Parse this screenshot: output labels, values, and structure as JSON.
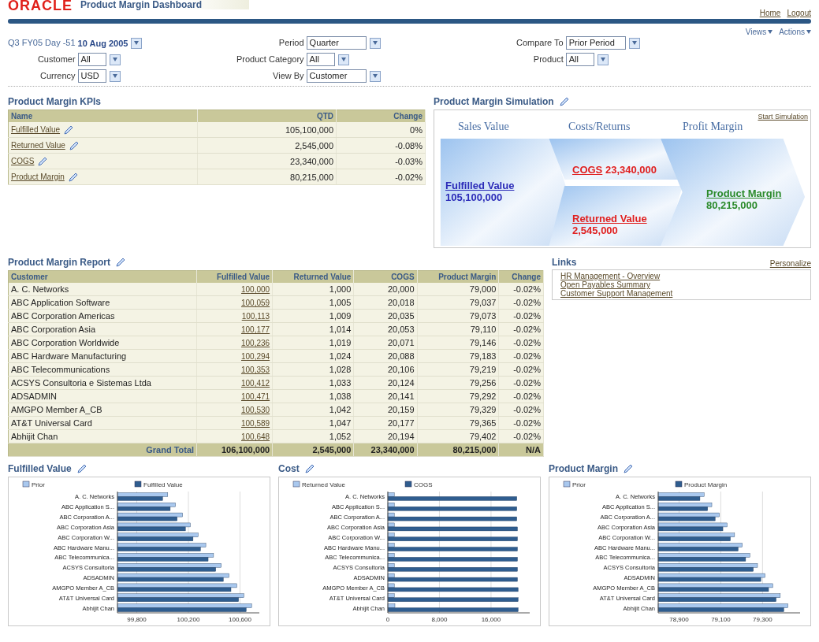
{
  "header": {
    "logo": "ORACLE",
    "title": "Product Margin Dashboard",
    "links": [
      "Home",
      "Logout"
    ]
  },
  "menus": [
    "Views",
    "Actions"
  ],
  "filter_columns": [
    [
      {
        "kind": "date",
        "label": "Q3 FY05 Day -51",
        "value": "10 Aug 2005"
      },
      {
        "kind": "select",
        "label": "Customer",
        "value": "All"
      },
      {
        "kind": "select",
        "label": "Currency",
        "value": "USD"
      }
    ],
    [
      {
        "kind": "select",
        "label": "Period",
        "value": "Quarter"
      },
      {
        "kind": "select",
        "label": "Product Category",
        "value": "All"
      },
      {
        "kind": "select",
        "label": "View By",
        "value": "Customer"
      }
    ],
    [
      {
        "kind": "select",
        "label": "Compare To",
        "value": "Prior Period"
      },
      {
        "kind": "select",
        "label": "Product",
        "value": "All"
      }
    ]
  ],
  "kpis": {
    "title": "Product Margin KPIs",
    "columns": [
      "Name",
      "QTD",
      "Change"
    ],
    "rows": [
      {
        "name": "Fulfilled Value",
        "qtd": "105,100,000",
        "change": "0%"
      },
      {
        "name": "Returned Value",
        "qtd": "2,545,000",
        "change": "-0.08%"
      },
      {
        "name": "COGS",
        "qtd": "23,340,000",
        "change": "-0.03%"
      },
      {
        "name": "Product Margin",
        "qtd": "80,215,000",
        "change": "-0.02%"
      }
    ]
  },
  "simulation": {
    "title": "Product Margin Simulation",
    "action": "Start Simulation",
    "stages": [
      "Sales Value",
      "Costs/Returns",
      "Profit Margin"
    ],
    "items": [
      {
        "label": "Fulfilled Value",
        "value": "105,100,000",
        "color": "#2b2bb8"
      },
      {
        "label": "COGS",
        "value": "23,340,000",
        "color": "#e02020"
      },
      {
        "label": "Returned Value",
        "value": "2,545,000",
        "color": "#e02020"
      },
      {
        "label": "Product Margin",
        "value": "80,215,000",
        "color": "#2a8a2a"
      }
    ]
  },
  "report": {
    "title": "Product Margin Report",
    "columns": [
      "Customer",
      "Fulfilled Value",
      "Returned Value",
      "COGS",
      "Product Margin",
      "Change"
    ],
    "rows": [
      [
        "A. C. Networks",
        "100,000",
        "1,000",
        "20,000",
        "79,000",
        "-0.02%"
      ],
      [
        "ABC Application Software",
        "100,059",
        "1,005",
        "20,018",
        "79,037",
        "-0.02%"
      ],
      [
        "ABC Corporation Americas",
        "100,113",
        "1,009",
        "20,035",
        "79,073",
        "-0.02%"
      ],
      [
        "ABC Corporation Asia",
        "100,177",
        "1,014",
        "20,053",
        "79,110",
        "-0.02%"
      ],
      [
        "ABC Corporation Worldwide",
        "100,236",
        "1,019",
        "20,071",
        "79,146",
        "-0.02%"
      ],
      [
        "ABC Hardware Manufacturing",
        "100,294",
        "1,024",
        "20,088",
        "79,183",
        "-0.02%"
      ],
      [
        "ABC Telecommunications",
        "100,353",
        "1,028",
        "20,106",
        "79,219",
        "-0.02%"
      ],
      [
        "ACSYS Consultoria e Sistemas Ltda",
        "100,412",
        "1,033",
        "20,124",
        "79,256",
        "-0.02%"
      ],
      [
        "ADSADMIN",
        "100,471",
        "1,038",
        "20,141",
        "79,292",
        "-0.02%"
      ],
      [
        "AMGPO Member A_CB",
        "100,530",
        "1,042",
        "20,159",
        "79,329",
        "-0.02%"
      ],
      [
        "AT&T Universal Card",
        "100,589",
        "1,047",
        "20,177",
        "79,365",
        "-0.02%"
      ],
      [
        "Abhijit Chan",
        "100,648",
        "1,052",
        "20,194",
        "79,402",
        "-0.02%"
      ]
    ],
    "total": [
      "Grand Total",
      "106,100,000",
      "2,545,000",
      "23,340,000",
      "80,215,000",
      "N/A"
    ]
  },
  "links": {
    "title": "Links",
    "action": "Personalize",
    "items": [
      "HR Management - Overview",
      "Open Payables Summary",
      "Customer Support Management"
    ]
  },
  "charts": [
    {
      "title": "Fulfilled Value",
      "chart_data": {
        "type": "bar",
        "orientation": "horizontal",
        "categories": [
          "A. C. Networks",
          "ABC Application S...",
          "ABC Corporation A...",
          "ABC Corporation Asia",
          "ABC Corporation W...",
          "ABC Hardware Manu...",
          "ABC Telecommunica...",
          "ACSYS Consultoria",
          "ADSADMIN",
          "AMGPO Member A_CB",
          "AT&T Universal Card",
          "Abhijit Chan"
        ],
        "series": [
          {
            "name": "Prior",
            "color": "#a9c8ee",
            "values": [
              100040,
              100100,
              100155,
              100215,
              100275,
              100335,
              100395,
              100455,
              100515,
              100575,
              100630,
              100690
            ]
          },
          {
            "name": "Fulfilled Value",
            "color": "#2f5d8f",
            "values": [
              100000,
              100059,
              100113,
              100177,
              100236,
              100294,
              100353,
              100412,
              100471,
              100530,
              100589,
              100648
            ]
          }
        ],
        "legend": true,
        "grid": true,
        "xlim": [
          99650,
          100750
        ],
        "xticks": [
          {
            "value": 99800,
            "label": "99,800"
          },
          {
            "value": 100200,
            "label": "100,200"
          },
          {
            "value": 100600,
            "label": "100,600"
          }
        ]
      }
    },
    {
      "title": "Cost",
      "chart_data": {
        "type": "bar",
        "orientation": "horizontal",
        "categories": [
          "A. C. Networks",
          "ABC Application S...",
          "ABC Corporation A...",
          "ABC Corporation Asia",
          "ABC Corporation W...",
          "ABC Hardware Manu...",
          "ABC Telecommunica...",
          "ACSYS Consultoria",
          "ADSADMIN",
          "AMGPO Member A_CB",
          "AT&T Universal Card",
          "Abhijit Chan"
        ],
        "series": [
          {
            "name": "Returned Value",
            "color": "#a9c8ee",
            "values": [
              1000,
              1000,
              1000,
              1000,
              1000,
              1000,
              1000,
              1000,
              1000,
              1000,
              1000,
              1100
            ]
          },
          {
            "name": "COGS",
            "color": "#2f5d8f",
            "values": [
              20000,
              20000,
              20000,
              20100,
              20100,
              20100,
              20100,
              20100,
              20100,
              20200,
              20200,
              20200
            ]
          }
        ],
        "legend": true,
        "grid": true,
        "xlim": [
          0,
          22000
        ],
        "xticks": [
          {
            "value": 0,
            "label": "0"
          },
          {
            "value": 8000,
            "label": "8,000"
          },
          {
            "value": 16000,
            "label": "16,000"
          }
        ]
      }
    },
    {
      "title": "Product Margin",
      "chart_data": {
        "type": "bar",
        "orientation": "horizontal",
        "categories": [
          "A. C. Networks",
          "ABC Application S...",
          "ABC Corporation A...",
          "ABC Corporation Asia",
          "ABC Corporation W...",
          "ABC Hardware Manu...",
          "ABC Telecommunica...",
          "ACSYS Consultoria",
          "ADSADMIN",
          "AMGPO Member A_CB",
          "AT&T Universal Card",
          "Abhijit Chan"
        ],
        "series": [
          {
            "name": "Prior",
            "color": "#a9c8ee",
            "values": [
              79020,
              79057,
              79093,
              79130,
              79166,
              79203,
              79239,
              79276,
              79312,
              79349,
              79385,
              79422
            ]
          },
          {
            "name": "Product Margin",
            "color": "#2f5d8f",
            "values": [
              79000,
              79037,
              79073,
              79110,
              79146,
              79183,
              79219,
              79256,
              79292,
              79329,
              79365,
              79402
            ]
          }
        ],
        "legend": true,
        "grid": true,
        "xlim": [
          78800,
          79480
        ],
        "xticks": [
          {
            "value": 78900,
            "label": "78,900"
          },
          {
            "value": 79100,
            "label": "79,100"
          },
          {
            "value": 79300,
            "label": "79,300"
          }
        ]
      }
    }
  ]
}
